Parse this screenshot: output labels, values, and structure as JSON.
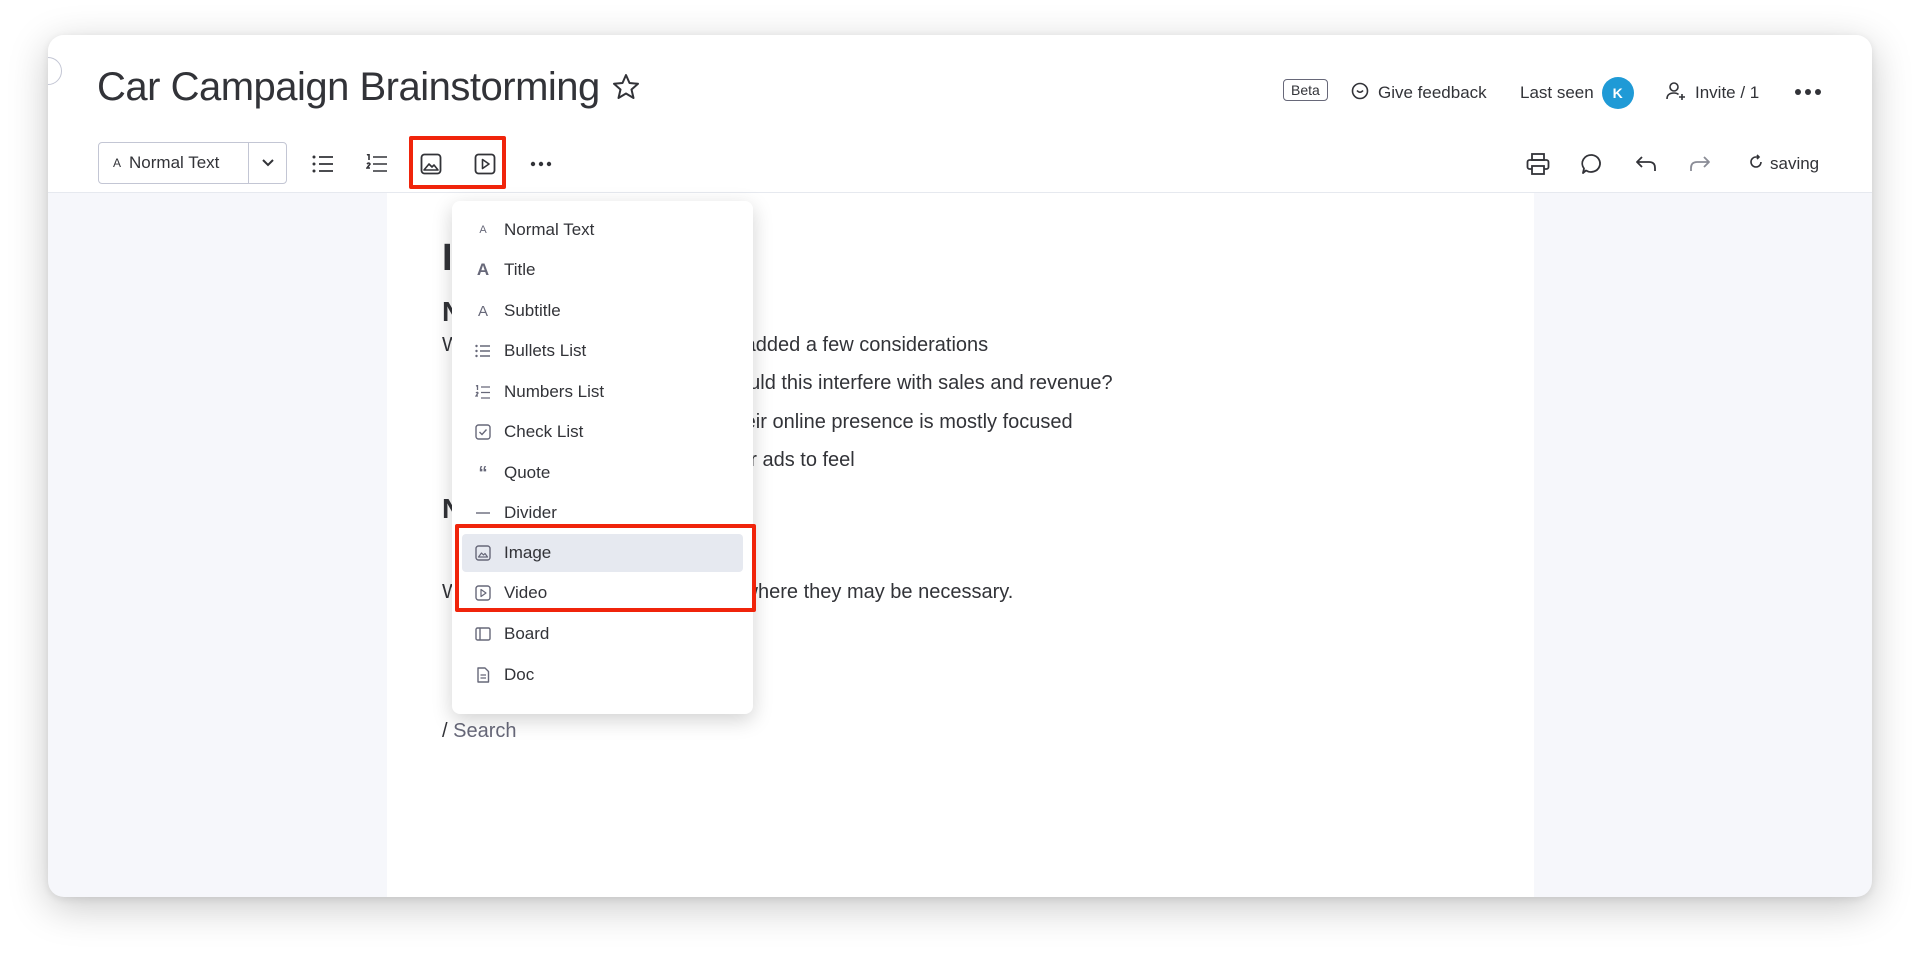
{
  "header": {
    "title": "Car Campaign Brainstorming",
    "beta_label": "Beta",
    "feedback_label": "Give feedback",
    "last_seen_label": "Last seen",
    "avatar_initial": "K",
    "invite_label": "Invite / 1"
  },
  "toolbar": {
    "text_style_value": "Normal Text",
    "text_style_glyph": "A",
    "status_label": "saving"
  },
  "document": {
    "line1": "d added a few considerations",
    "line2": "could this interfere with sales and revenue?",
    "line3": "their online presence is mostly focused",
    "line4": "our ads to feel",
    "line5": "s where they may be necessary.",
    "heading_initial": "I",
    "sub1_initial": "N",
    "sub2_initial": "N",
    "w1": "W",
    "w2": "W",
    "search_slash": "/",
    "search_placeholder": "Search"
  },
  "menu": {
    "items": [
      {
        "label": "Normal Text",
        "icon": "text-small-icon"
      },
      {
        "label": "Title",
        "icon": "title-icon"
      },
      {
        "label": "Subtitle",
        "icon": "subtitle-icon"
      },
      {
        "label": "Bullets List",
        "icon": "bullets-icon"
      },
      {
        "label": "Numbers List",
        "icon": "numbers-icon"
      },
      {
        "label": "Check List",
        "icon": "checklist-icon"
      },
      {
        "label": "Quote",
        "icon": "quote-icon"
      },
      {
        "label": "Divider",
        "icon": "divider-icon"
      },
      {
        "label": "Image",
        "icon": "image-icon"
      },
      {
        "label": "Video",
        "icon": "video-icon"
      },
      {
        "label": "Board",
        "icon": "board-icon"
      },
      {
        "label": "Doc",
        "icon": "doc-icon"
      }
    ],
    "selected": "Image"
  },
  "colors": {
    "highlight": "#f0240b",
    "avatar": "#1f9ad6",
    "text": "#323338"
  }
}
